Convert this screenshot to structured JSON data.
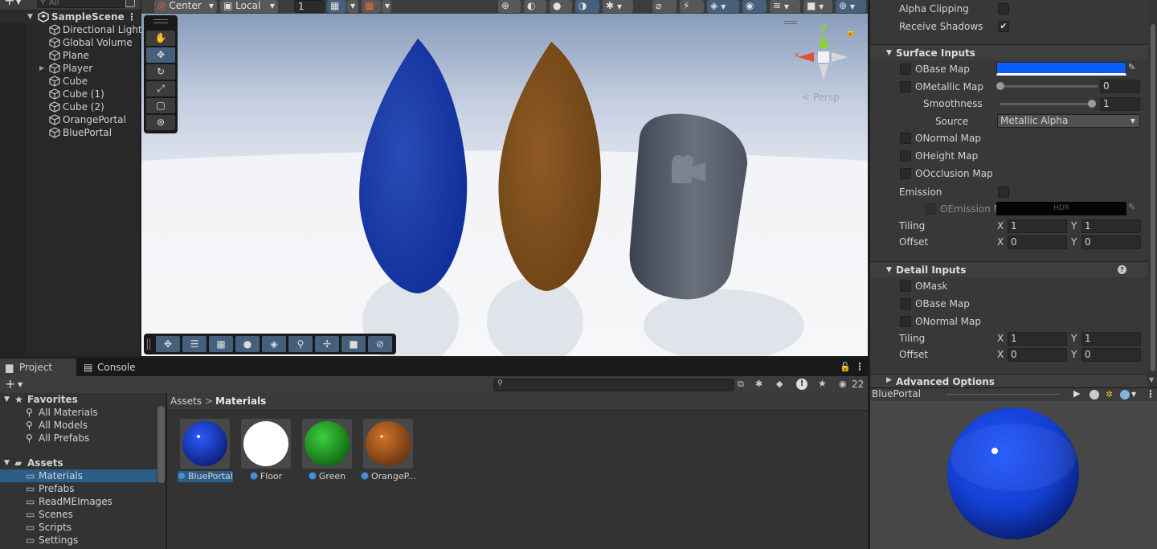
{
  "hierarchy": {
    "search_placeholder": "All",
    "scene_name": "SampleScene",
    "items": [
      {
        "label": "Directional Light"
      },
      {
        "label": "Global Volume"
      },
      {
        "label": "Plane"
      },
      {
        "label": "Player"
      },
      {
        "label": "Cube"
      },
      {
        "label": "Cube (1)"
      },
      {
        "label": "Cube (2)"
      },
      {
        "label": "OrangePortal"
      },
      {
        "label": "BluePortal"
      }
    ]
  },
  "scene": {
    "toolbar": {
      "pivot_label": "Center",
      "space_label": "Local",
      "grid_value": "1"
    },
    "gizmo": {
      "y_label": "y",
      "x_label": "x",
      "persp_label": "< Persp"
    }
  },
  "inspector": {
    "alpha_clipping_label": "Alpha Clipping",
    "receive_shadows_label": "Receive Shadows",
    "receive_shadows_checked": "✔",
    "surface_inputs_title": "Surface Inputs",
    "base_map_label": "Base Map",
    "base_map_color": "#0a5cff",
    "metallic_map_label": "Metallic Map",
    "metallic_value": "0",
    "smoothness_label": "Smoothness",
    "smoothness_value": "1",
    "source_label": "Source",
    "source_value": "Metallic Alpha",
    "normal_map_label": "Normal Map",
    "height_map_label": "Height Map",
    "occlusion_map_label": "Occlusion Map",
    "emission_label": "Emission",
    "emission_map_label": "Emission M",
    "hdr_label": "HDR",
    "tiling_label": "Tiling",
    "offset_label": "Offset",
    "x_label": "X",
    "y_label": "Y",
    "tiling_x": "1",
    "tiling_y": "1",
    "offset_x": "0",
    "offset_y": "0",
    "detail_inputs_title": "Detail Inputs",
    "mask_label": "Mask",
    "detail_base_map_label": "Base Map",
    "detail_normal_map_label": "Normal Map",
    "detail_tiling_x": "1",
    "detail_tiling_y": "1",
    "detail_offset_x": "0",
    "detail_offset_y": "0",
    "advanced_options_title": "Advanced Options"
  },
  "preview": {
    "title": "BluePortal"
  },
  "project": {
    "tabs": [
      {
        "label": "Project"
      },
      {
        "label": "Console"
      }
    ],
    "hidden_count": "22",
    "favorites_label": "Favorites",
    "favorites": [
      {
        "label": "All Materials"
      },
      {
        "label": "All Models"
      },
      {
        "label": "All Prefabs"
      }
    ],
    "assets_label": "Assets",
    "folders": [
      {
        "label": "Materials"
      },
      {
        "label": "Prefabs"
      },
      {
        "label": "ReadMEImages"
      },
      {
        "label": "Scenes"
      },
      {
        "label": "Scripts"
      },
      {
        "label": "Settings"
      }
    ],
    "breadcrumb": {
      "root": "Assets",
      "separator": ">",
      "current": "Materials"
    },
    "materials": [
      {
        "label": "BluePortal",
        "color": "#1a3fc7"
      },
      {
        "label": "Floor",
        "color": "#ffffff"
      },
      {
        "label": "Green",
        "color": "#1fa31f"
      },
      {
        "label": "OrangeP...",
        "color": "#b85a1a"
      }
    ]
  }
}
